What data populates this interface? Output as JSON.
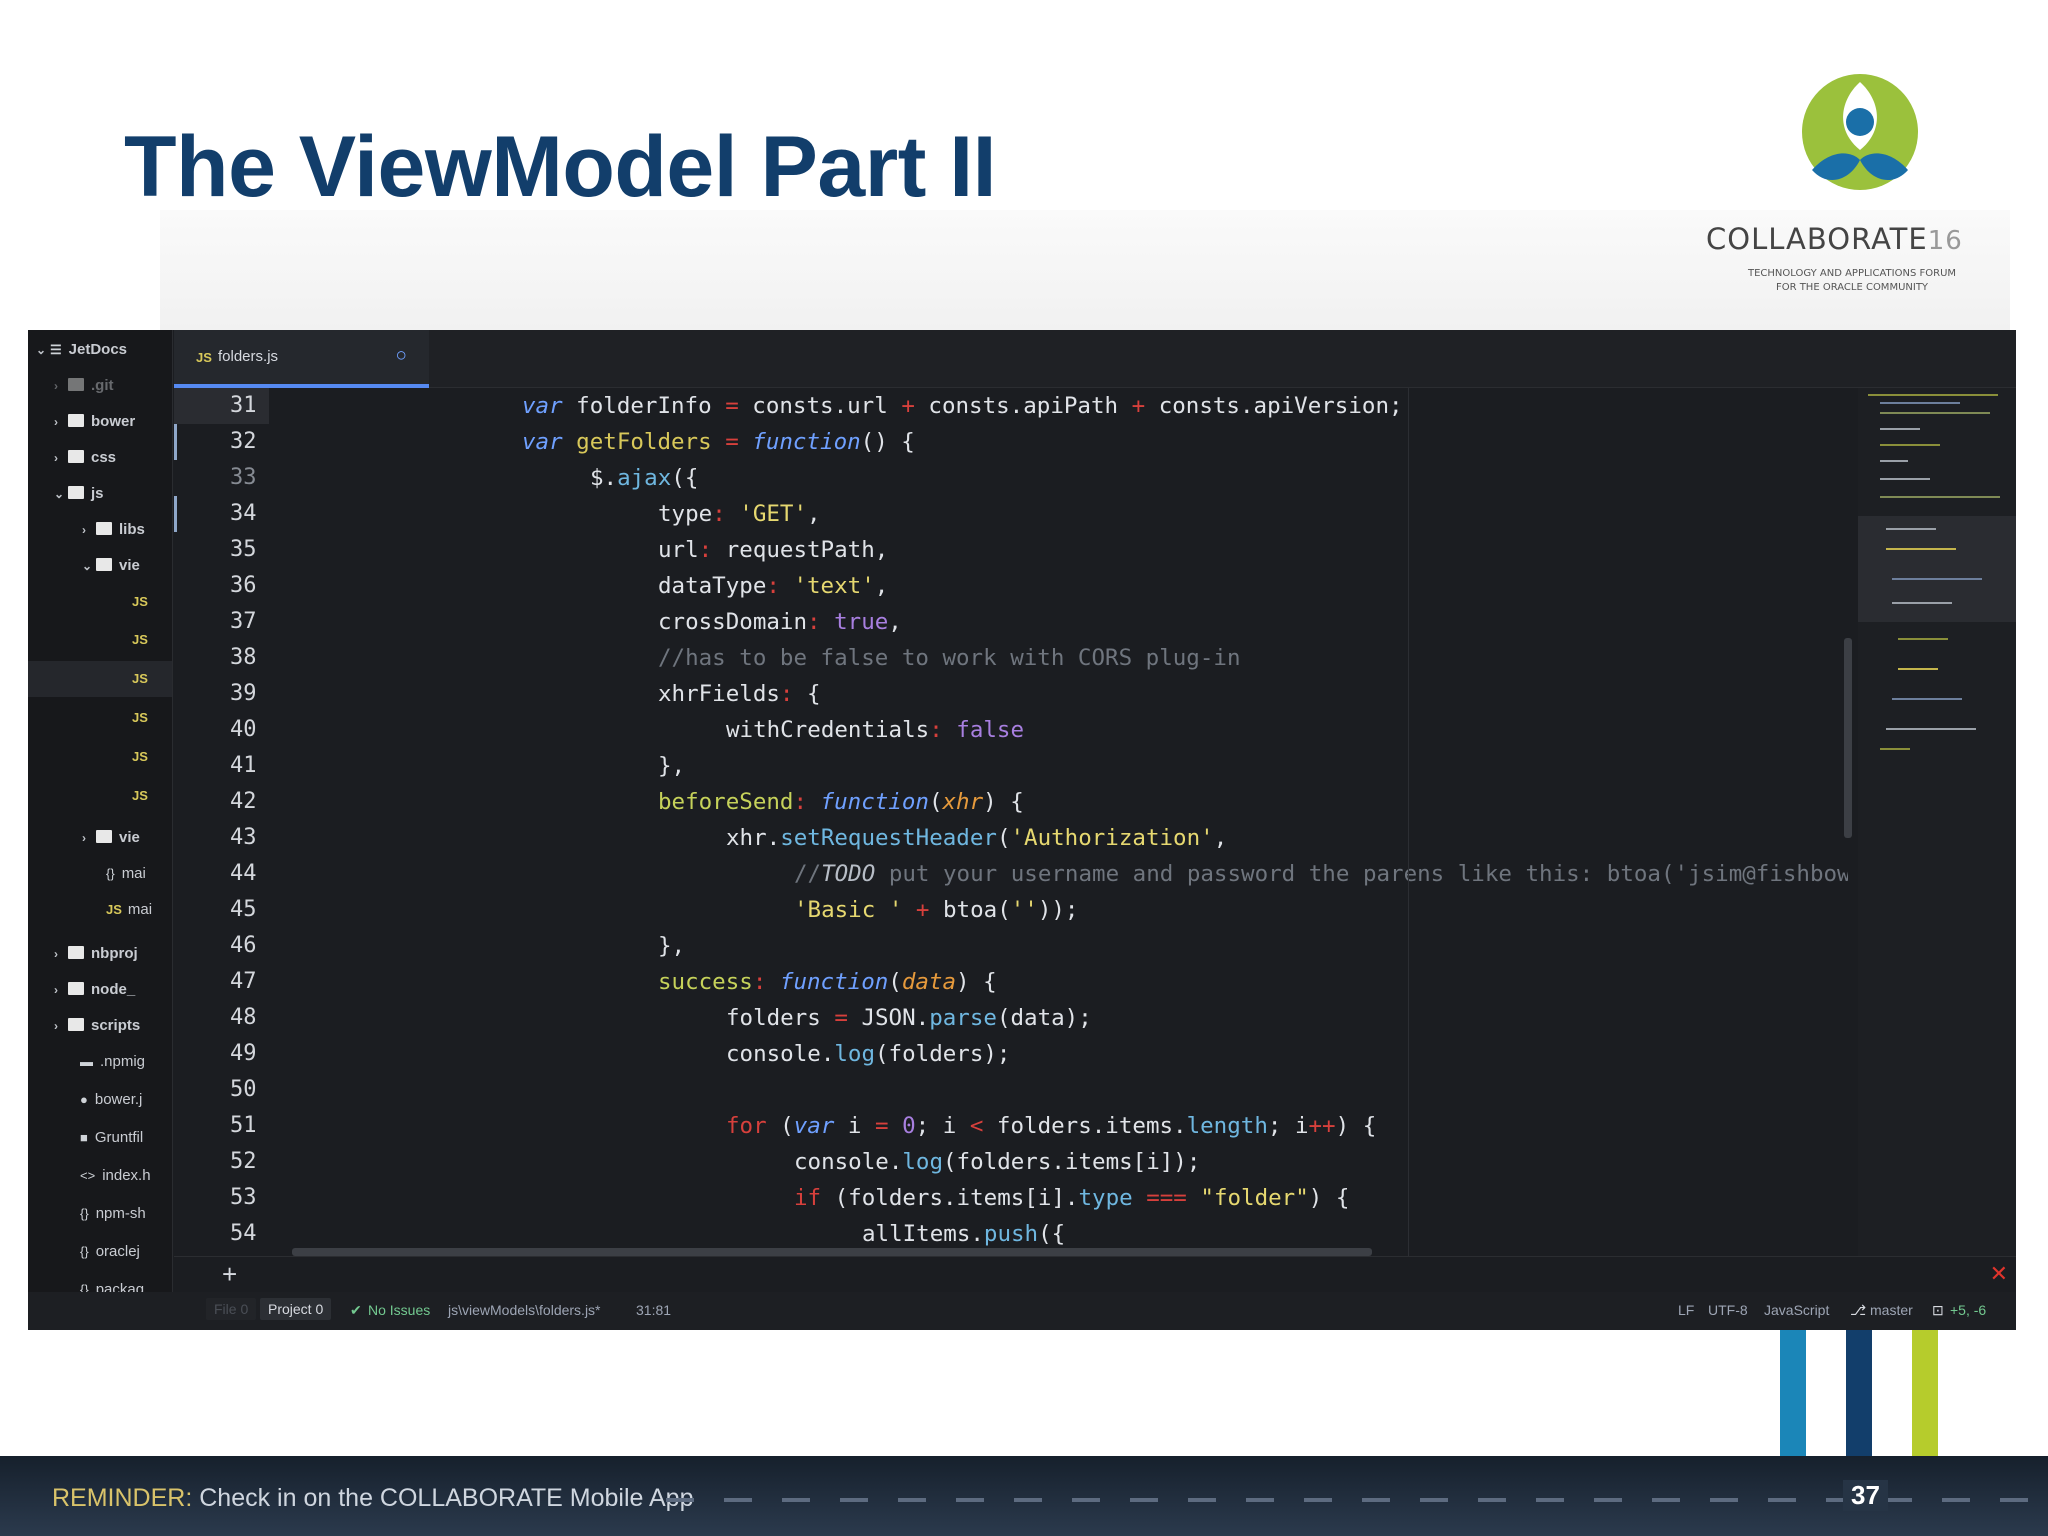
{
  "slide": {
    "title": "The ViewModel Part II",
    "page_number": "37",
    "reminder_label": "REMINDER:",
    "reminder_text": "Check in on the COLLABORATE Mobile App"
  },
  "logo": {
    "wordmark": "COLLABORATE",
    "year": "16",
    "tagline_line1": "TECHNOLOGY AND APPLICATIONS FORUM",
    "tagline_line2": "FOR THE ORACLE COMMUNITY",
    "colors": {
      "green": "#9bc13c",
      "blue": "#1a6fa8",
      "dark_blue": "#123e6b"
    }
  },
  "editor": {
    "tab": {
      "icon": "JS",
      "name": "folders.js"
    },
    "tree": [
      {
        "type": "root",
        "label": "JetDocs"
      },
      {
        "type": "folder",
        "label": ".git"
      },
      {
        "type": "folder",
        "label": "bower"
      },
      {
        "type": "folder",
        "label": "css"
      },
      {
        "type": "folder-open",
        "label": "js"
      },
      {
        "type": "folder",
        "label": "libs"
      },
      {
        "type": "folder-open",
        "label": "vie"
      },
      {
        "type": "jsfile",
        "label": ""
      },
      {
        "type": "jsfile",
        "label": ""
      },
      {
        "type": "jsfile",
        "label": ""
      },
      {
        "type": "jsfile",
        "label": ""
      },
      {
        "type": "jsfile",
        "label": ""
      },
      {
        "type": "jsfile",
        "label": ""
      },
      {
        "type": "folder",
        "label": "vie"
      },
      {
        "type": "json",
        "label": "mai"
      },
      {
        "type": "js",
        "label": "mai"
      },
      {
        "type": "folder",
        "label": "nbproj"
      },
      {
        "type": "folder",
        "label": "node_"
      },
      {
        "type": "folder",
        "label": "scripts"
      },
      {
        "type": "file",
        "label": ".npmig"
      },
      {
        "type": "file",
        "label": "bower.j"
      },
      {
        "type": "file",
        "label": "Gruntfil"
      },
      {
        "type": "html",
        "label": "index.h"
      },
      {
        "type": "json",
        "label": "npm-sh"
      },
      {
        "type": "json",
        "label": "oraclej"
      },
      {
        "type": "json",
        "label": "packag"
      }
    ],
    "line_numbers": [
      "31",
      "32",
      "33",
      "34",
      "35",
      "36",
      "37",
      "38",
      "39",
      "40",
      "41",
      "42",
      "43",
      "44",
      "45",
      "46",
      "47",
      "48",
      "49",
      "50",
      "51",
      "52",
      "53",
      "54"
    ],
    "code": {
      "l31": {
        "kw": "var",
        "a": " folderInfo ",
        "op": "=",
        "b": " consts.url ",
        "op2": "+",
        "c": " consts.apiPath ",
        "op3": "+",
        "d": " consts.apiVersion;"
      },
      "l32": {
        "kw": "var",
        "fn": " getFolders ",
        "op": "=",
        "kw2": " function",
        "e": "() {"
      },
      "l33": {
        "a": "$.",
        "meth": "ajax",
        "b": "({"
      },
      "l34": {
        "key": "type",
        "p": ":",
        "str": " 'GET'",
        "e": ","
      },
      "l35": {
        "key": "url",
        "p": ":",
        "b": " requestPath,"
      },
      "l36": {
        "key": "dataType",
        "p": ":",
        "str": " 'text'",
        "e": ","
      },
      "l37": {
        "key": "crossDomain",
        "p": ":",
        "bool": " true",
        "e": ","
      },
      "l38": {
        "cmt": "//has to be false to work with CORS plug-in"
      },
      "l39": {
        "key": "xhrFields",
        "p": ":",
        "e": " {"
      },
      "l40": {
        "key": "withCredentials",
        "p": ":",
        "bool": " false"
      },
      "l41": {
        "e": "},"
      },
      "l42": {
        "key": "beforeSend",
        "p": ":",
        "kw": " function",
        "a": "(",
        "param": "xhr",
        "b": ") {"
      },
      "l43": {
        "a": "xhr.",
        "meth": "setRequestHeader",
        "b": "(",
        "str": "'Authorization'",
        "e": ","
      },
      "l44": {
        "cmt": "//",
        "todo": "TODO",
        "cmt2": " put your username and password the parens like this: btoa('jsim@fishbow"
      },
      "l45": {
        "str": "'Basic '",
        "op": " +",
        "a": " btoa(",
        "str2": "''",
        "b": "));"
      },
      "l46": {
        "e": "},"
      },
      "l47": {
        "key": "success",
        "p": ":",
        "kw": " function",
        "a": "(",
        "param": "data",
        "b": ") {"
      },
      "l48": {
        "a": "folders ",
        "op": "=",
        "b": " JSON.",
        "meth": "parse",
        "c": "(data);"
      },
      "l49": {
        "a": "console.",
        "meth": "log",
        "b": "(folders);"
      },
      "l50": {},
      "l51": {
        "ctl": "for",
        "a": " (",
        "kw": "var",
        "b": " i ",
        "op": "=",
        "num": " 0",
        "c": "; i ",
        "op2": "<",
        "d": " folders.items.",
        "meth": "length",
        "e": "; i",
        "op3": "++",
        "f": ") {"
      },
      "l52": {
        "a": "console.",
        "meth": "log",
        "b": "(folders.items[i]);"
      },
      "l53": {
        "ctl": "if",
        "a": " (folders.items[i].",
        "meth": "type",
        "op": " ===",
        "str": " \"folder\"",
        "b": ") {"
      },
      "l54": {
        "a": "allItems.",
        "meth": "push",
        "b": "({"
      }
    },
    "status": {
      "file_btn": "File 0",
      "project_btn": "Project 0",
      "issues": "No Issues",
      "path": "js\\viewModels\\folders.js*",
      "cursor": "31:81",
      "line_ending": "LF",
      "encoding": "UTF-8",
      "grammar": "JavaScript",
      "branch": "master",
      "diff": "+5, -6"
    }
  }
}
